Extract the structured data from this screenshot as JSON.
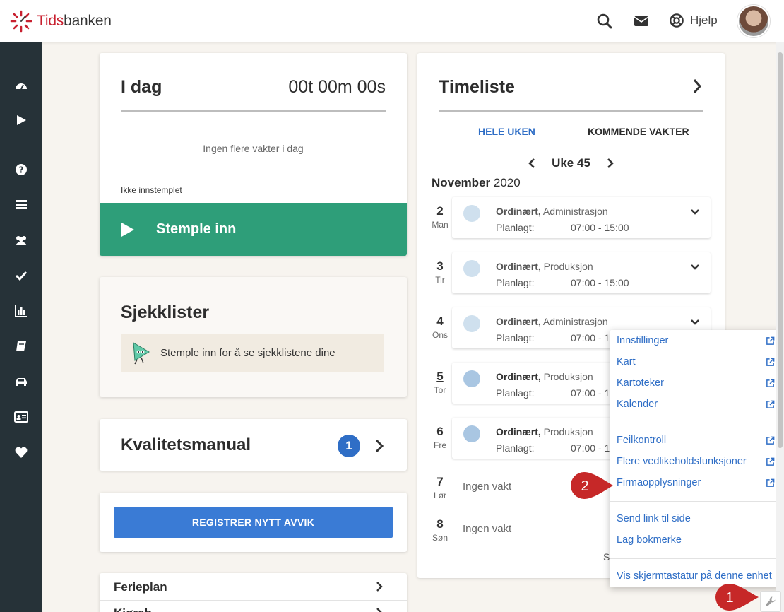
{
  "header": {
    "logo_part1": "Tids",
    "logo_part2": "banken",
    "help_label": "Hjelp",
    "icons": [
      "search-icon",
      "mail-icon",
      "lifebuoy-icon"
    ]
  },
  "sidebar": {
    "icons": [
      "dashboard-icon",
      "play-icon",
      "question-icon",
      "list-icon",
      "users-icon",
      "check-icon",
      "bar-chart-icon",
      "book-icon",
      "car-icon",
      "id-card-icon",
      "heart-icon"
    ]
  },
  "today": {
    "title": "I dag",
    "timer": "00t 00m 00s",
    "empty_text": "Ingen flere vakter i dag",
    "status": "Ikke innstemplet",
    "stamp_label": "Stemple inn"
  },
  "checklists": {
    "title": "Sjekklister",
    "message": "Stemple inn for å se sjekklistene dine"
  },
  "quality": {
    "title": "Kvalitetsmanual",
    "badge": "1"
  },
  "deviation": {
    "button_label": "REGISTRER NYTT AVVIK"
  },
  "links": {
    "ferieplan": "Ferieplan",
    "next_partial": "Kjøreb"
  },
  "timesheet": {
    "title": "Timeliste",
    "tab_week": "HELE UKEN",
    "tab_upcoming": "KOMMENDE VAKTER",
    "week_label": "Uke 45",
    "month": "November",
    "year": "2020",
    "planned_label": "Planlagt:",
    "no_shift_text": "Ingen vakt",
    "truncated_text": "S",
    "days": [
      {
        "num": "2",
        "name": "Man",
        "type": "Ordinært,",
        "dept": "Administrasjon",
        "time": "07:00 - 15:00"
      },
      {
        "num": "3",
        "name": "Tir",
        "type": "Ordinært,",
        "dept": "Produksjon",
        "time": "07:00 - 15:00"
      },
      {
        "num": "4",
        "name": "Ons",
        "type": "Ordinært,",
        "dept": "Administrasjon",
        "time": "07:00 - 1"
      },
      {
        "num": "5",
        "name": "Tor",
        "type": "Ordinært,",
        "dept": "Produksjon",
        "time": "07:00 - 1"
      },
      {
        "num": "6",
        "name": "Fre",
        "type": "Ordinært,",
        "dept": "Produksjon",
        "time": "07:00 - 1"
      },
      {
        "num": "7",
        "name": "Lør"
      },
      {
        "num": "8",
        "name": "Søn"
      }
    ]
  },
  "menu": {
    "group1": [
      "Innstillinger",
      "Kart",
      "Kartoteker",
      "Kalender"
    ],
    "group2": [
      "Feilkontroll",
      "Flere vedlikeholdsfunksjoner",
      "Firmaopplysninger"
    ],
    "group3": [
      "Send link til side",
      "Lag bokmerke"
    ],
    "group4": [
      "Vis skjermtastatur på denne enhet"
    ]
  },
  "callouts": {
    "one": "1",
    "two": "2"
  },
  "colors": {
    "brand_red": "#c8202f",
    "sidebar": "#263238",
    "stamp_green": "#2e9e79",
    "link_blue": "#2f6ec6",
    "button_blue": "#3a7bd5",
    "callout_red": "#c62828",
    "background": "#f7f4ef"
  }
}
